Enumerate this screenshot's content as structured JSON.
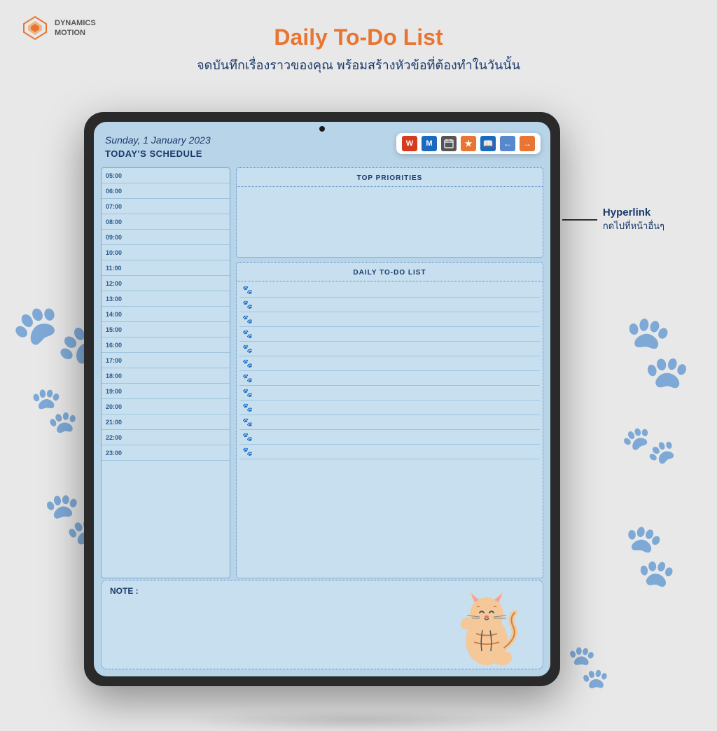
{
  "logo": {
    "text_line1": "DYNAMICS",
    "text_line2": "MOTION"
  },
  "header": {
    "main_title_part1": "Daily ",
    "main_title_part2": "To-Do List",
    "subtitle": "จดบันทึกเรื่องราวของคุณ พร้อมสร้างหัวข้อที่ต้องทำในวันนั้น"
  },
  "hyperlink": {
    "label": "Hyperlink",
    "sublabel": "กดไปที่หน้าอื่นๆ"
  },
  "tablet": {
    "date": "Sunday, 1 January  2023",
    "schedule_title": "TODAY'S SCHEDULE",
    "toolbar_buttons": [
      "W",
      "M",
      "📅",
      "★",
      "📖",
      "←",
      "→"
    ],
    "top_priorities_header": "TOP PRIORITIES",
    "daily_todo_header": "DAILY TO-DO LIST",
    "note_label": "NOTE :",
    "times": [
      "05:00",
      "06:00",
      "07:00",
      "08:00",
      "09:00",
      "10:00",
      "11:00",
      "12:00",
      "13:00",
      "14:00",
      "15:00",
      "16:00",
      "17:00",
      "18:00",
      "19:00",
      "20:00",
      "21:00",
      "22:00",
      "23:00"
    ],
    "todo_items": 12
  },
  "colors": {
    "dark_blue": "#1a3a6b",
    "orange": "#e87532",
    "tablet_bg": "#b8d4e8",
    "schedule_bg": "#c8dff0",
    "border_color": "#5588bb"
  }
}
